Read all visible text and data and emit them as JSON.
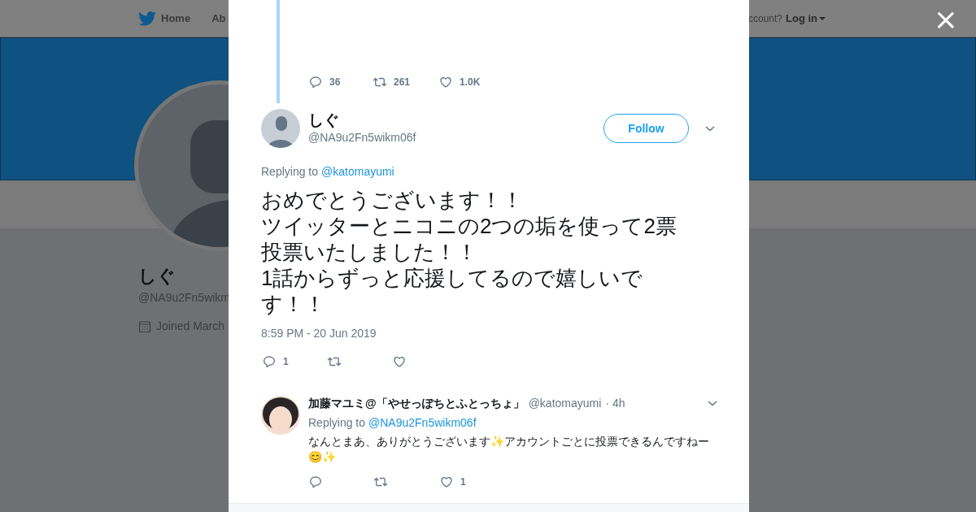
{
  "background": {
    "nav": {
      "home": "Home",
      "about": "Ab",
      "account_prompt": "ccount?",
      "login": "Log in"
    },
    "profile": {
      "name": "しぐ",
      "handle": "@NA9u2Fn5wikm",
      "joined": "Joined March"
    }
  },
  "modal": {
    "previous_tweet": {
      "actions": [
        {
          "kind": "reply",
          "count": "36"
        },
        {
          "kind": "retweet",
          "count": "261"
        },
        {
          "kind": "like",
          "count": "1.0K"
        }
      ]
    },
    "tweet": {
      "name": "しぐ",
      "handle": "@NA9u2Fn5wikm06f",
      "follow_button": "Follow",
      "replying_label": "Replying to",
      "replying_to": "@katomayumi",
      "text_lines": [
        "おめでとうございます！！",
        "ツイッターとニコニの2つの垢を使って2票",
        "投票いたしました！！",
        "1話からずっと応援してるので嬉しいです！！"
      ],
      "timestamp": "8:59 PM - 20 Jun 2019",
      "actions": [
        {
          "kind": "reply",
          "count": "1"
        },
        {
          "kind": "retweet"
        },
        {
          "kind": "like"
        }
      ]
    },
    "replies": [
      {
        "name": "加藤マユミ@「やせっぽちとふとっちょ」",
        "handle": "@katomayumi",
        "time": "· 4h",
        "replying_label": "Replying to",
        "replying_to": "@NA9u2Fn5wikm06f",
        "text": "なんとまあ、ありがとうございます✨アカウントごとに投票できるんですねー😊✨",
        "actions": [
          {
            "kind": "reply"
          },
          {
            "kind": "retweet"
          },
          {
            "kind": "like",
            "count": "1"
          }
        ]
      }
    ]
  },
  "close_button": "×"
}
